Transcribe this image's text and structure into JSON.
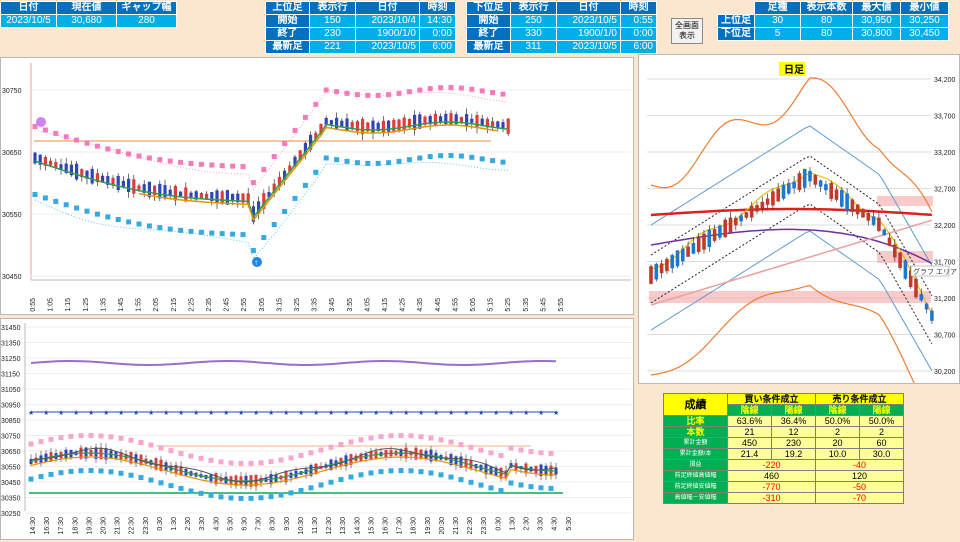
{
  "top_left": {
    "headers": [
      "日付",
      "現在値",
      "ギャップ幅"
    ],
    "values": [
      "2023/10/5",
      "30,680",
      "280"
    ]
  },
  "upper_foot": {
    "headers": [
      "上位足",
      "表示行",
      "日付",
      "時刻"
    ],
    "rows": [
      [
        "開始",
        "150",
        "2023/10/4",
        "14:30"
      ],
      [
        "終了",
        "230",
        "1900/1/0",
        "0:00"
      ],
      [
        "最新足",
        "221",
        "2023/10/5",
        "6:00"
      ]
    ]
  },
  "lower_foot": {
    "headers": [
      "下位足",
      "表示行",
      "日付",
      "時刻"
    ],
    "rows": [
      [
        "開始",
        "250",
        "2023/10/5",
        "0:55"
      ],
      [
        "終了",
        "330",
        "1900/1/0",
        "0:00"
      ],
      [
        "最新足",
        "311",
        "2023/10/5",
        "6:00"
      ]
    ]
  },
  "full_button": "全画面\n表示",
  "summary": {
    "headers": [
      "",
      "足種",
      "表示本数",
      "最大値",
      "最小値"
    ],
    "rows": [
      [
        "上位足",
        "30",
        "80",
        "30,950",
        "30,250"
      ],
      [
        "下位足",
        "5",
        "80",
        "30,800",
        "30,450"
      ]
    ]
  },
  "chart1": {
    "yticks": [
      "30750",
      "30650",
      "30550",
      "30450"
    ],
    "xticks": [
      "0:55",
      "1:05",
      "1:15",
      "1:25",
      "1:35",
      "1:45",
      "1:55",
      "2:05",
      "2:15",
      "2:25",
      "2:35",
      "2:45",
      "2:55",
      "3:05",
      "3:15",
      "3:25",
      "3:35",
      "3:45",
      "3:55",
      "4:05",
      "4:15",
      "4:25",
      "4:35",
      "4:45",
      "4:55",
      "5:05",
      "5:15",
      "5:25",
      "5:35",
      "5:45",
      "5:55"
    ]
  },
  "chart2": {
    "yticks": [
      "31450",
      "31350",
      "31250",
      "31150",
      "31050",
      "30950",
      "30850",
      "30750",
      "30650",
      "30550",
      "30450",
      "30350",
      "30250"
    ],
    "xticks": [
      "14:30",
      "16:30",
      "17:30",
      "18:30",
      "19:30",
      "20:30",
      "21:30",
      "22:30",
      "23:30",
      "0:30",
      "1:30",
      "2:30",
      "3:30",
      "4:30",
      "5:30",
      "6:30",
      "7:30",
      "8:30",
      "9:30",
      "10:30",
      "11:30",
      "12:30",
      "13:30",
      "14:30",
      "15:30",
      "16:30",
      "17:30",
      "18:30",
      "19:30",
      "20:30",
      "21:30",
      "22:30",
      "23:30",
      "0:30",
      "1:30",
      "2:30",
      "3:30",
      "4:30",
      "5:30"
    ]
  },
  "chart3": {
    "title": "日足",
    "yticks": [
      "34,200",
      "33,700",
      "33,200",
      "32,700",
      "32,200",
      "31,700",
      "31,200",
      "30,700",
      "30,200"
    ],
    "tooltip": "グラフ エリア"
  },
  "results": {
    "title": "成績",
    "buy": "買い条件成立",
    "sell": "売り条件成立",
    "sub": [
      "陰線",
      "陽線",
      "陰線",
      "陽線"
    ],
    "rows": [
      {
        "label": "比率",
        "vals": [
          "63.6%",
          "36.4%",
          "50.0%",
          "50.0%"
        ]
      },
      {
        "label": "本数",
        "vals": [
          "21",
          "12",
          "2",
          "2"
        ]
      },
      {
        "label": "累計金額",
        "vals": [
          "450",
          "230",
          "20",
          "60"
        ]
      },
      {
        "label": "累計金額/本",
        "vals": [
          "21.4",
          "19.2",
          "10.0",
          "30.0"
        ]
      }
    ],
    "rows2": [
      {
        "label": "損益",
        "buy": "-220",
        "sell": "-40"
      },
      {
        "label": "前足終値高値幅",
        "buy": "460",
        "sell": "120"
      },
      {
        "label": "前足終値安値幅",
        "buy": "-770",
        "sell": "-50"
      },
      {
        "label": "高値幅－安値幅",
        "buy": "-310",
        "sell": "-70"
      }
    ]
  }
}
